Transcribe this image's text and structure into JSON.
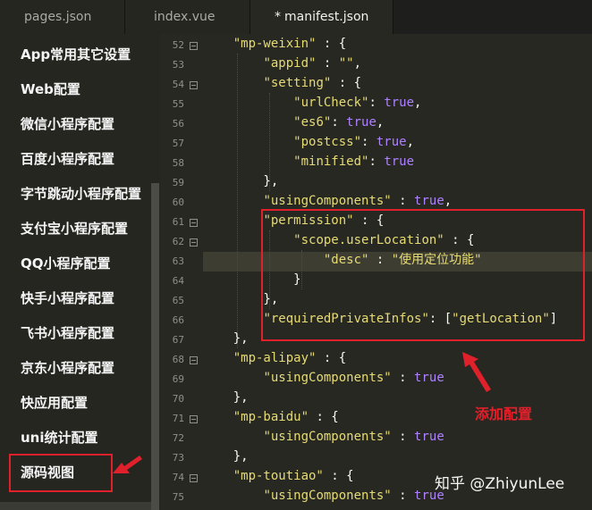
{
  "tabs": [
    {
      "label": "pages.json"
    },
    {
      "label": "index.vue"
    },
    {
      "label": "manifest.json",
      "modified_mark": "*"
    }
  ],
  "sidebar": {
    "items": [
      {
        "label": "App常用其它设置"
      },
      {
        "label": "Web配置"
      },
      {
        "label": "微信小程序配置"
      },
      {
        "label": "百度小程序配置"
      },
      {
        "label": "字节跳动小程序配置"
      },
      {
        "label": "支付宝小程序配置"
      },
      {
        "label": "QQ小程序配置"
      },
      {
        "label": "快手小程序配置"
      },
      {
        "label": "飞书小程序配置"
      },
      {
        "label": "京东小程序配置"
      },
      {
        "label": "快应用配置"
      },
      {
        "label": "uni统计配置"
      },
      {
        "label": "源码视图"
      }
    ]
  },
  "editor": {
    "lines": [
      {
        "n": "52"
      },
      {
        "n": "53"
      },
      {
        "n": "54"
      },
      {
        "n": "55"
      },
      {
        "n": "56"
      },
      {
        "n": "57"
      },
      {
        "n": "58"
      },
      {
        "n": "59"
      },
      {
        "n": "60"
      },
      {
        "n": "61"
      },
      {
        "n": "62"
      },
      {
        "n": "63"
      },
      {
        "n": "64"
      },
      {
        "n": "65"
      },
      {
        "n": "66"
      },
      {
        "n": "67"
      },
      {
        "n": "68"
      },
      {
        "n": "69"
      },
      {
        "n": "70"
      },
      {
        "n": "71"
      },
      {
        "n": "72"
      },
      {
        "n": "73"
      },
      {
        "n": "74"
      },
      {
        "n": "75"
      }
    ],
    "tokens": {
      "mp_weixin": "\"mp-weixin\"",
      "appid": "\"appid\"",
      "appid_val": "\"\"",
      "setting": "\"setting\"",
      "urlCheck": "\"urlCheck\"",
      "es6": "\"es6\"",
      "postcss": "\"postcss\"",
      "minified": "\"minified\"",
      "usingComponents": "\"usingComponents\"",
      "permission": "\"permission\"",
      "scope_userLocation": "\"scope.userLocation\"",
      "desc": "\"desc\"",
      "desc_val": "\"使用定位功能\"",
      "requiredPrivateInfos": "\"requiredPrivateInfos\"",
      "getLocation": "\"getLocation\"",
      "mp_alipay": "\"mp-alipay\"",
      "mp_baidu": "\"mp-baidu\"",
      "mp_toutiao": "\"mp-toutiao\"",
      "true": "true"
    }
  },
  "annotation": "添加配置",
  "watermark": "知乎 @ZhiyunLee",
  "colors": {
    "highlight_box": "#e0202a",
    "string": "#e6db74",
    "boolean": "#ae81ff"
  }
}
